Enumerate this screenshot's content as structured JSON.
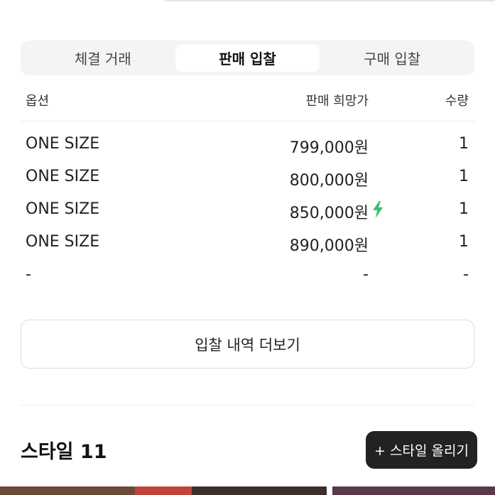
{
  "tabs": [
    {
      "label": "체결 거래",
      "active": false
    },
    {
      "label": "판매 입찰",
      "active": true
    },
    {
      "label": "구매 입찰",
      "active": false
    }
  ],
  "table": {
    "headers": {
      "option": "옵션",
      "price": "판매 희망가",
      "qty": "수량"
    },
    "rows": [
      {
        "option": "ONE SIZE",
        "price": "799,000원",
        "qty": "1",
        "fast": false
      },
      {
        "option": "ONE SIZE",
        "price": "800,000원",
        "qty": "1",
        "fast": false
      },
      {
        "option": "ONE SIZE",
        "price": "850,000원",
        "qty": "1",
        "fast": true
      },
      {
        "option": "ONE SIZE",
        "price": "890,000원",
        "qty": "1",
        "fast": false
      },
      {
        "option": "-",
        "price": "-",
        "qty": "-",
        "fast": false
      }
    ]
  },
  "more_button": {
    "label": "입찰 내역 더보기"
  },
  "style_section": {
    "title": "스타일 11",
    "upload_label": "+ 스타일 올리기"
  },
  "colors": {
    "accent_bolt": "#31c46a",
    "button_dark": "#222222"
  },
  "icons": {
    "fast_delivery": "lightning-bolt-icon"
  }
}
